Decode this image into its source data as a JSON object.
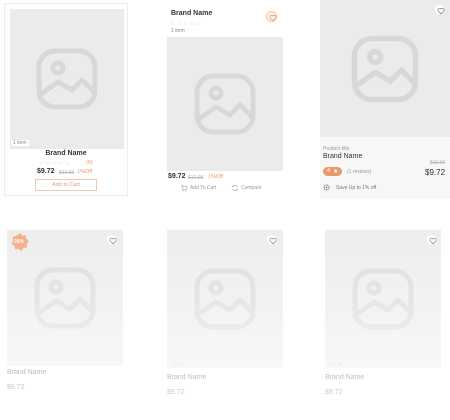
{
  "cards": [
    {
      "items_label": "1 item",
      "brand": "Brand Name",
      "stars": "☆☆☆☆☆",
      "rating_count": "(0)",
      "price": "$9.72",
      "old_price": "$12.00",
      "discount": "1%Off",
      "add_to_cart": "Add to Cart"
    },
    {
      "brand": "Brand Name",
      "stars": "☆☆☆☆☆",
      "items_label": "1 item",
      "price": "$9.72",
      "old_price": "$12.00",
      "discount": "1%Off",
      "add_to_cart": "Add To Cart",
      "compare": "Compare"
    },
    {
      "product_title": "Product title",
      "brand": "Brand Name",
      "rating_badge": "4",
      "reviews": "(1 reviews)",
      "old_price": "$10.00",
      "price": "$9.72",
      "save_text": "Save Up to 1% off"
    },
    {
      "sale_badge": "25%",
      "brand": "Brand Name",
      "price": "$9.72"
    },
    {
      "brand": "Brand Name",
      "price": "$9.72"
    },
    {
      "brand": "Brand Name",
      "price": "$9.72"
    }
  ],
  "icons": {
    "placeholder": "image-placeholder-icon",
    "wishlist": "heart-icon",
    "cart": "cart-icon",
    "compare": "compare-icon",
    "save": "gear-icon"
  },
  "colors": {
    "accent": "#e99a6b",
    "placeholder_bg": "#ebebeb",
    "placeholder_icon": "#d8d8d8"
  }
}
